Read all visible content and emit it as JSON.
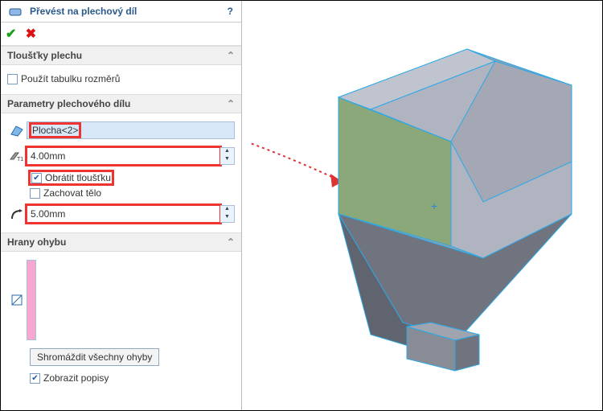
{
  "header": {
    "title": "Převést na plechový díl",
    "help": "?"
  },
  "confirm": {
    "ok": "✔",
    "cancel": "✖"
  },
  "sect1": {
    "title": "Tloušťky plechu",
    "cb": "Použít tabulku rozměrů"
  },
  "sect2": {
    "title": "Parametry plechového dílu",
    "face": "Plocha<2>",
    "thick": "4.00mm",
    "rev": "Obrátit tloušťku",
    "keep": "Zachovat tělo",
    "rad": "5.00mm"
  },
  "sect3": {
    "title": "Hrany ohybu",
    "btn": "Shromáždit všechny ohyby",
    "cb": "Zobrazit popisy"
  },
  "caret": "⌃"
}
